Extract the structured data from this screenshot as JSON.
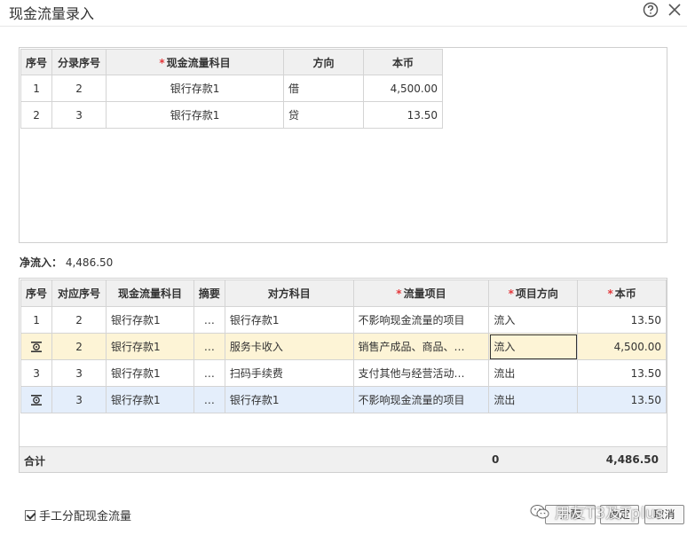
{
  "dialog": {
    "title": "现金流量录入"
  },
  "top_table": {
    "headers": [
      "序号",
      "分录序号",
      "现金流量科目",
      "方向",
      "本币"
    ],
    "required": [
      false,
      false,
      true,
      false,
      false
    ],
    "rows": [
      {
        "seq": "1",
        "entry_seq": "2",
        "account": "银行存款1",
        "direction": "借",
        "amount": "4,500.00"
      },
      {
        "seq": "2",
        "entry_seq": "3",
        "account": "银行存款1",
        "direction": "贷",
        "amount": "13.50"
      }
    ]
  },
  "net_inflow": {
    "label": "净流入：",
    "value": "4,486.50"
  },
  "bottom_table": {
    "headers": [
      "序号",
      "对应序号",
      "现金流量科目",
      "摘要",
      "对方科目",
      "流量项目",
      "项目方向",
      "本币"
    ],
    "required": [
      false,
      false,
      false,
      false,
      false,
      true,
      true,
      true
    ],
    "rows": [
      {
        "seq": "1",
        "corr_seq": "2",
        "account": "银行存款1",
        "summary": "…",
        "counter_account": "银行存款1",
        "flow_item": "不影响现金流量的项目",
        "item_direction": "流入",
        "amount": "13.50"
      },
      {
        "seq": "",
        "corr_seq": "2",
        "account": "银行存款1",
        "summary": "…",
        "counter_account": "服务卡收入",
        "flow_item": "销售产成品、商品、…",
        "item_direction": "流入",
        "amount": "4,500.00"
      },
      {
        "seq": "3",
        "corr_seq": "3",
        "account": "银行存款1",
        "summary": "…",
        "counter_account": "扫码手续费",
        "flow_item": "支付其他与经营活动…",
        "item_direction": "流出",
        "amount": "13.50"
      },
      {
        "seq": "",
        "corr_seq": "3",
        "account": "银行存款1",
        "summary": "…",
        "counter_account": "银行存款1",
        "flow_item": "不影响现金流量的项目",
        "item_direction": "流出",
        "amount": "13.50"
      }
    ],
    "total": {
      "label": "合计",
      "item_direction": "0",
      "amount": "4,486.50"
    }
  },
  "footer": {
    "manual_assign_label": "手工分配现金流量",
    "manual_assign_checked": true,
    "assign_button": "分配",
    "ok_button": "确定",
    "cancel_button": "取消",
    "watermark": "用友T3及Tplus"
  },
  "colors": {
    "required_mark": "#e4393c",
    "highlight_row": "#fdf4d6",
    "selected_row": "#e4eefb",
    "header_bg": "#f0f0f0"
  }
}
